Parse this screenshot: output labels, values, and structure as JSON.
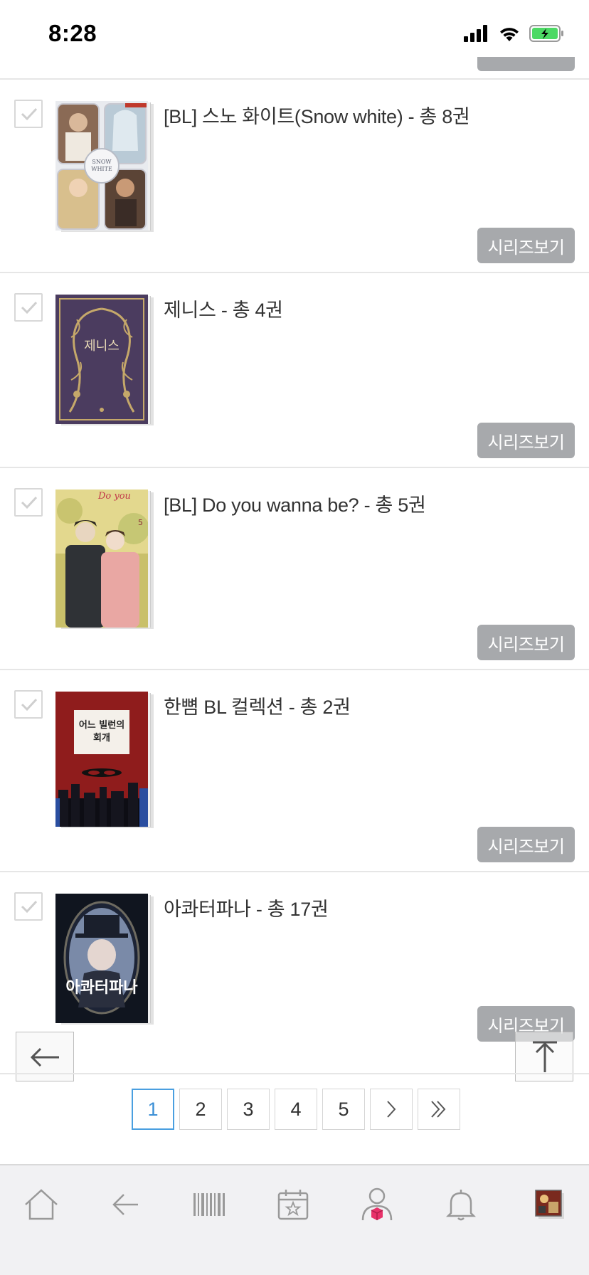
{
  "status_bar": {
    "time": "8:28",
    "icons": [
      "signal-icon",
      "wifi-icon",
      "battery-charging-icon"
    ],
    "battery_color": "#4cd964"
  },
  "books": [
    {
      "title": "[BL] 스노 화이트(Snow white) - 총 8권",
      "series_button": "시리즈보기",
      "checked": false
    },
    {
      "title": "제니스 - 총 4권",
      "series_button": "시리즈보기",
      "checked": false
    },
    {
      "title": "[BL] Do you wanna be? - 총 5권",
      "series_button": "시리즈보기",
      "checked": false
    },
    {
      "title": "한뼘 BL 컬렉션 - 총 2권",
      "series_button": "시리즈보기",
      "checked": false
    },
    {
      "title": "아콰터파나 - 총 17권",
      "series_button": "시리즈보기",
      "checked": false
    }
  ],
  "cover_text": {
    "book2": "제니스",
    "book3": "Do you",
    "book3_volume": "5",
    "book4_line1": "어느 빌런의",
    "book4_line2": "회개",
    "book5": "아콰터파나"
  },
  "floating": {
    "back_icon": "arrow-left-icon",
    "top_icon": "arrow-up-icon"
  },
  "pagination": {
    "pages": [
      "1",
      "2",
      "3",
      "4",
      "5"
    ],
    "current": "1",
    "next_icon": "chevron-right-icon",
    "last_icon": "double-chevron-right-icon",
    "active_color": "#3b8fd6"
  },
  "tab_bar": {
    "tabs": [
      "home-icon",
      "back-arrow-icon",
      "barcode-icon",
      "calendar-star-icon",
      "user-icon",
      "bell-icon",
      "recent-book-thumbnail"
    ],
    "accent": "#e8326a"
  },
  "colors": {
    "series_button_bg": "#a7a9ac",
    "divider": "#e6e6e6",
    "tab_bar_bg": "#f1f1f3"
  }
}
